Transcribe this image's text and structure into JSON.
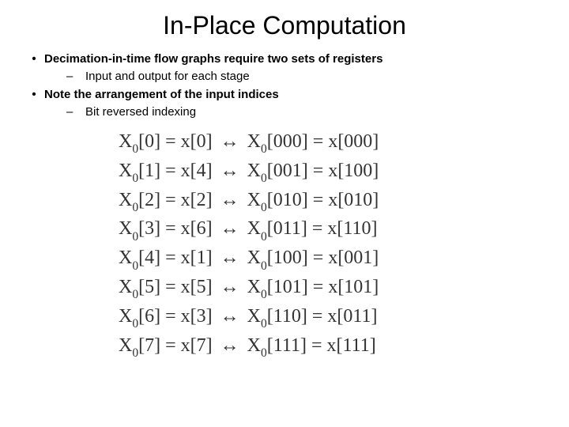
{
  "title": "In-Place Computation",
  "bullets": {
    "b1": "Decimation-in-time flow graphs require two sets of registers",
    "b1a": "Input and output for each stage",
    "b2": "Note the arrangement of the input indices",
    "b2a": "Bit reversed indexing"
  },
  "marks": {
    "dot": "•",
    "dash": "–"
  },
  "eq": [
    {
      "d": "0",
      "s": "0",
      "db": "000",
      "sb": "000"
    },
    {
      "d": "1",
      "s": "4",
      "db": "001",
      "sb": "100"
    },
    {
      "d": "2",
      "s": "2",
      "db": "010",
      "sb": "010"
    },
    {
      "d": "3",
      "s": "6",
      "db": "011",
      "sb": "110"
    },
    {
      "d": "4",
      "s": "1",
      "db": "100",
      "sb": "001"
    },
    {
      "d": "5",
      "s": "5",
      "db": "101",
      "sb": "101"
    },
    {
      "d": "6",
      "s": "3",
      "db": "110",
      "sb": "011"
    },
    {
      "d": "7",
      "s": "7",
      "db": "111",
      "sb": "111"
    }
  ],
  "sym": {
    "X": "X",
    "x": "x",
    "zero": "0",
    "eq": "=",
    "lrarrow": "↔",
    "lb": "[",
    "rb": "]"
  }
}
